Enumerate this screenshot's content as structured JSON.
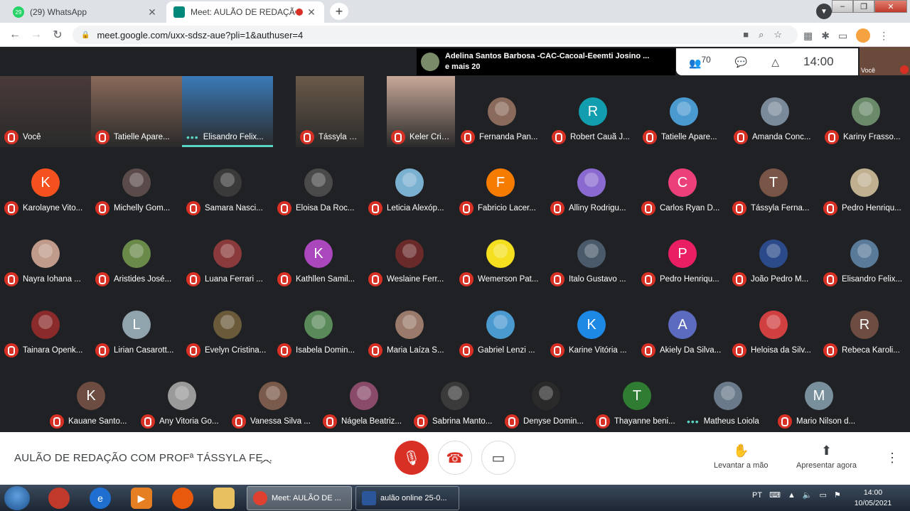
{
  "browser": {
    "tabs": [
      {
        "title": "(29) WhatsApp",
        "badge": "29",
        "color": "#25d366"
      },
      {
        "title": "Meet: AULÃO DE REDAÇÃO",
        "color": "#00897b"
      }
    ],
    "url": "meet.google.com/uxx-sdsz-aue?pli=1&authuser=4",
    "new_tab": "+",
    "close_glyph": "✕"
  },
  "meet": {
    "speaker": {
      "line1": "Adelina Santos Barbosa -CAC-Cacoal-Eeemti Josino ...",
      "line2": "e mais 20"
    },
    "participants_count": "70",
    "clock": "14:00",
    "self_label": "Você",
    "meeting_title": "AULÃO DE REDAÇÃO COM PROFª TÁSSYLA FE...",
    "actions": {
      "raise_hand": "Levantar a mão",
      "present": "Apresentar agora"
    }
  },
  "video_tiles": [
    {
      "name": "Você",
      "color": "#4a3a3a"
    },
    {
      "name": "Tatielle Apare...",
      "color": "#8a6a5a"
    },
    {
      "name": "Elisandro Felix...",
      "color": "#3a7ab8",
      "speaking": true
    },
    {
      "name": "Tássyla Ferna...",
      "color": "#6a5a4a"
    },
    {
      "name": "Keler Cristina ...",
      "color": "#c8a898"
    }
  ],
  "grid_rows": [
    [
      {
        "name": "Fernanda Pan...",
        "letter": "",
        "color": "#8a6a5a"
      },
      {
        "name": "Robert Cauã J...",
        "letter": "R",
        "color": "#129eaf"
      },
      {
        "name": "Tatielle Apare...",
        "letter": "",
        "color": "#4a9ad0"
      },
      {
        "name": "Amanda Conc...",
        "letter": "",
        "color": "#7a8a9a"
      },
      {
        "name": "Kariny Frasso...",
        "letter": "",
        "color": "#6a8a6a"
      }
    ],
    [
      {
        "name": "Karolayne Vito...",
        "letter": "K",
        "color": "#f4511e"
      },
      {
        "name": "Michelly Gom...",
        "letter": "",
        "color": "#5a4a4a"
      },
      {
        "name": "Samara Nasci...",
        "letter": "",
        "color": "#3a3a3a"
      },
      {
        "name": "Eloisa Da Roc...",
        "letter": "",
        "color": "#4a4a4a"
      },
      {
        "name": "Leticia Alexóp...",
        "letter": "",
        "color": "#7ab0d0"
      },
      {
        "name": "Fabricio Lacer...",
        "letter": "F",
        "color": "#f57c00"
      },
      {
        "name": "Alliny Rodrigu...",
        "letter": "",
        "color": "#8a6ad0"
      },
      {
        "name": "Carlos Ryan D...",
        "letter": "C",
        "color": "#ec407a"
      },
      {
        "name": "Tássyla Ferna...",
        "letter": "T",
        "color": "#795548"
      },
      {
        "name": "Pedro Henriqu...",
        "letter": "",
        "color": "#c0b090"
      }
    ],
    [
      {
        "name": "Nayra Iohana ...",
        "letter": "",
        "color": "#c09a8a"
      },
      {
        "name": "Aristides José...",
        "letter": "",
        "color": "#6a8a4a"
      },
      {
        "name": "Luana Ferrari ...",
        "letter": "",
        "color": "#8a3a3a"
      },
      {
        "name": "Kathllen Samil...",
        "letter": "K",
        "color": "#ab47bc"
      },
      {
        "name": "Weslaine Ferr...",
        "letter": "",
        "color": "#6a2a2a"
      },
      {
        "name": "Wemerson Pat...",
        "letter": "",
        "color": "#f5e020"
      },
      {
        "name": "Italo Gustavo ...",
        "letter": "",
        "color": "#4a5a6a"
      },
      {
        "name": "Pedro Henriqu...",
        "letter": "P",
        "color": "#e91e63"
      },
      {
        "name": "João Pedro M...",
        "letter": "",
        "color": "#2a4a8a"
      },
      {
        "name": "Elisandro Felix...",
        "letter": "",
        "color": "#5a7a9a"
      }
    ],
    [
      {
        "name": "Tainara Openk...",
        "letter": "",
        "color": "#8a2a2a"
      },
      {
        "name": "Lirian Casarott...",
        "letter": "L",
        "color": "#90a4ae"
      },
      {
        "name": "Evelyn Cristina...",
        "letter": "",
        "color": "#6a5a3a"
      },
      {
        "name": "Isabela Domin...",
        "letter": "",
        "color": "#5a8a5a"
      },
      {
        "name": "Maria Laíza S...",
        "letter": "",
        "color": "#9a7a6a"
      },
      {
        "name": "Gabriel Lenzi ...",
        "letter": "",
        "color": "#4a9ad0"
      },
      {
        "name": "Karine Vitória ...",
        "letter": "K",
        "color": "#1e88e5"
      },
      {
        "name": "Akiely Da Silva...",
        "letter": "A",
        "color": "#5c6bc0"
      },
      {
        "name": "Heloisa da Silv...",
        "letter": "",
        "color": "#d04040"
      },
      {
        "name": "Rebeca Karoli...",
        "letter": "R",
        "color": "#6d4c41"
      }
    ],
    [
      {
        "name": "Kauane Santo...",
        "letter": "K",
        "color": "#6d4c41"
      },
      {
        "name": "Any Vitoria Go...",
        "letter": "",
        "color": "#9a9a9a"
      },
      {
        "name": "Vanessa Silva ...",
        "letter": "",
        "color": "#7a5a4a"
      },
      {
        "name": "Nágela Beatriz...",
        "letter": "",
        "color": "#8a4a6a"
      },
      {
        "name": "Sabrina Manto...",
        "letter": "",
        "color": "#3a3a3a"
      },
      {
        "name": "Denyse Domin...",
        "letter": "",
        "color": "#2a2a2a"
      },
      {
        "name": "Thayanne beni...",
        "letter": "T",
        "color": "#2e7d32"
      },
      {
        "name": "Matheus Loiola",
        "letter": "",
        "color": "#6a7a8a",
        "speaking": true
      },
      {
        "name": "Mario Nilson d...",
        "letter": "M",
        "color": "#78909c"
      }
    ]
  ],
  "taskbar": {
    "tasks": [
      "Meet: AULÃO DE ...",
      "aulão online 25-0..."
    ],
    "lang": "PT",
    "time": "14:00",
    "date": "10/05/2021"
  }
}
